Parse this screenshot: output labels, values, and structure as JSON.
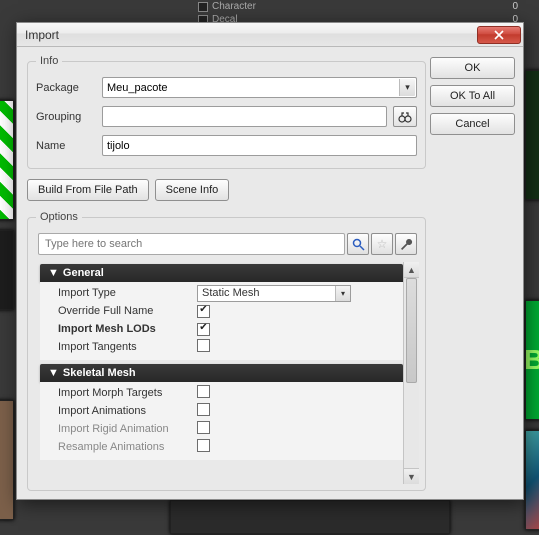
{
  "bg": {
    "items": [
      {
        "label": "Character",
        "count": "0"
      },
      {
        "label": "Decal",
        "count": "0"
      }
    ]
  },
  "dialog": {
    "title": "Import",
    "buttons": {
      "ok": "OK",
      "ok_all": "OK To All",
      "cancel": "Cancel"
    },
    "info": {
      "legend": "Info",
      "package_label": "Package",
      "package_value": "Meu_pacote",
      "grouping_label": "Grouping",
      "grouping_value": "",
      "name_label": "Name",
      "name_value": "tijolo",
      "build_btn": "Build From File Path",
      "scene_btn": "Scene Info"
    },
    "options": {
      "legend": "Options",
      "search_placeholder": "Type here to search",
      "groups": [
        {
          "title": "General",
          "rows": [
            {
              "label": "Import Type",
              "kind": "combo",
              "value": "Static Mesh"
            },
            {
              "label": "Override Full Name",
              "kind": "check",
              "checked": true
            },
            {
              "label": "Import Mesh LODs",
              "kind": "check",
              "checked": true,
              "bold": true
            },
            {
              "label": "Import Tangents",
              "kind": "check",
              "checked": false
            }
          ]
        },
        {
          "title": "Skeletal Mesh",
          "rows": [
            {
              "label": "Import Morph Targets",
              "kind": "check",
              "checked": false
            },
            {
              "label": "Import Animations",
              "kind": "check",
              "checked": false
            },
            {
              "label": "Import Rigid Animation",
              "kind": "check",
              "checked": false,
              "faded": true
            },
            {
              "label": "Resample Animations",
              "kind": "check",
              "checked": false,
              "faded": true
            }
          ]
        }
      ]
    }
  }
}
